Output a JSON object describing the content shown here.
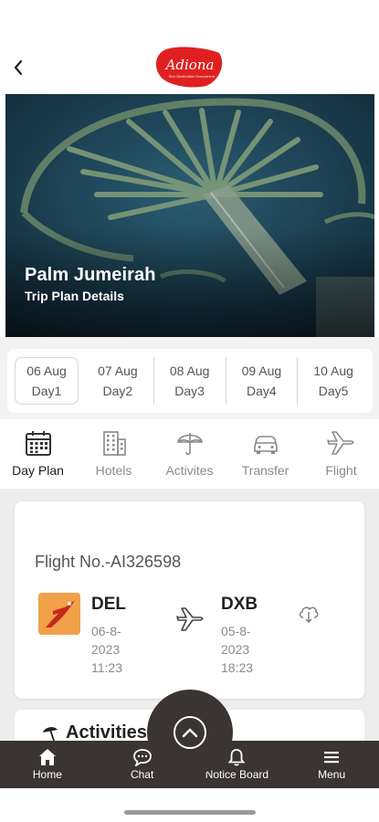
{
  "header": {
    "logo_text": "Adiona",
    "logo_tagline": "Your Destination Everywhere"
  },
  "hero": {
    "title": "Palm Jumeirah",
    "subtitle": "Trip Plan Details"
  },
  "days": [
    {
      "date": "06 Aug",
      "label": "Day1",
      "active": true
    },
    {
      "date": "07 Aug",
      "label": "Day2",
      "active": false
    },
    {
      "date": "08 Aug",
      "label": "Day3",
      "active": false
    },
    {
      "date": "09 Aug",
      "label": "Day4",
      "active": false
    },
    {
      "date": "10 Aug",
      "label": "Day5",
      "active": false
    }
  ],
  "categories": [
    {
      "label": "Day Plan",
      "icon": "calendar-icon",
      "active": true
    },
    {
      "label": "Hotels",
      "icon": "building-icon",
      "active": false
    },
    {
      "label": "Activites",
      "icon": "umbrella-icon",
      "active": false
    },
    {
      "label": "Transfer",
      "icon": "car-icon",
      "active": false
    },
    {
      "label": "Flight",
      "icon": "airplane-icon",
      "active": false
    }
  ],
  "flight": {
    "number": "Flight No.-AI326598",
    "from_code": "DEL",
    "from_date": "06-8-",
    "from_year": "2023",
    "from_time": "11:23",
    "to_code": "DXB",
    "to_date": "05-8-",
    "to_year": "2023",
    "to_time": "18:23"
  },
  "activities": {
    "title": "Activities"
  },
  "bottom_nav": {
    "home": "Home",
    "chat": "Chat",
    "notice": "Notice Board",
    "menu": "Menu"
  },
  "colors": {
    "nav_bg": "#3a3433",
    "brand_red": "#e02020",
    "airline_orange": "#f1a14a"
  }
}
